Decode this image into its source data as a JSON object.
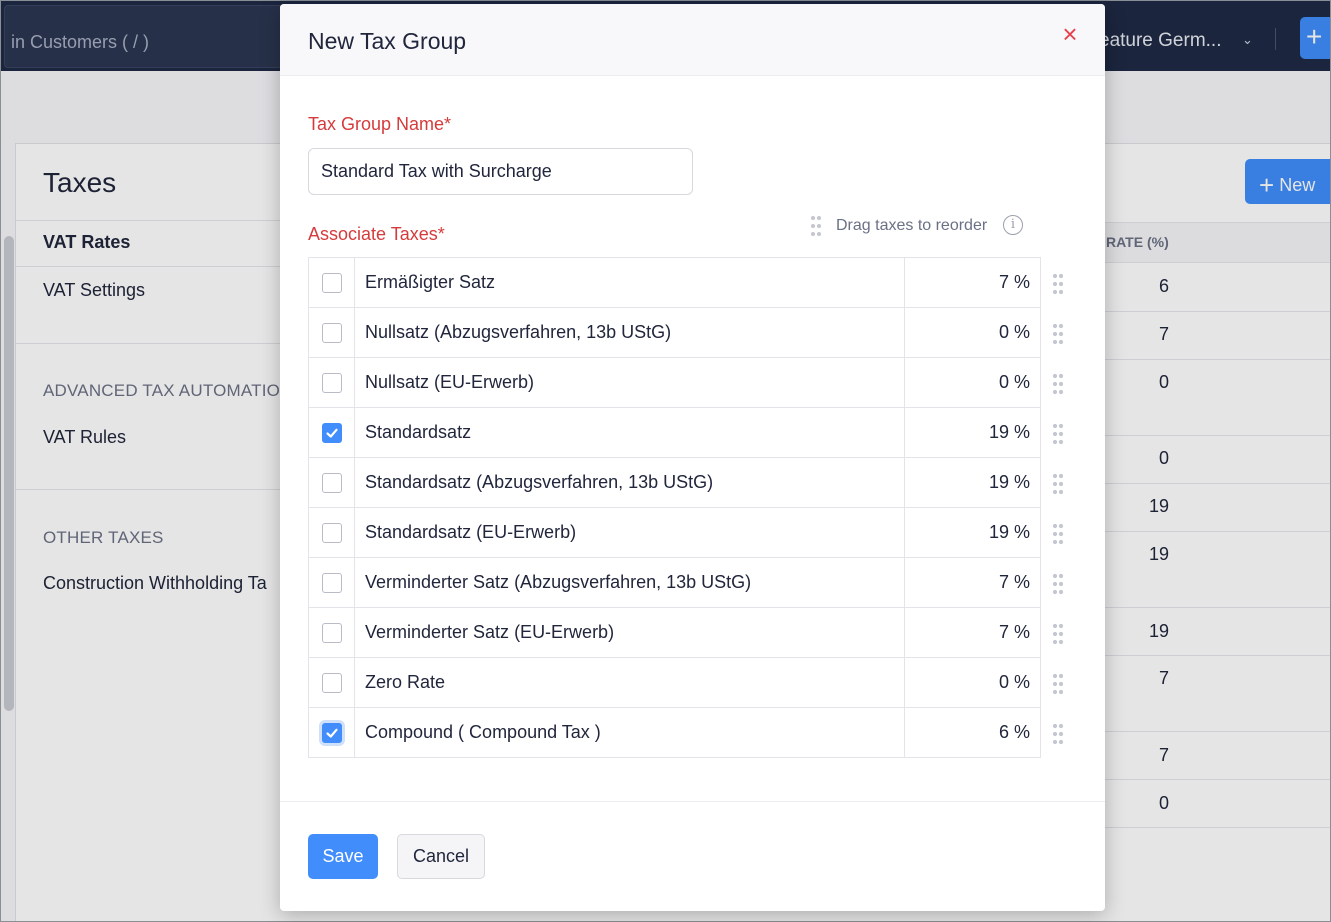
{
  "topbar": {
    "search_placeholder": "in Customers ( / )",
    "org_name": "eature Germ...",
    "quick_create_label": "+"
  },
  "sidebar": {
    "title": "Taxes",
    "items": [
      {
        "label": "VAT Rates",
        "active": true
      },
      {
        "label": "VAT Settings"
      }
    ],
    "sections": [
      {
        "heading": "ADVANCED TAX AUTOMATIO",
        "items": [
          {
            "label": "VAT Rules"
          }
        ]
      },
      {
        "heading": "OTHER TAXES",
        "items": [
          {
            "label": "Construction Withholding Ta"
          }
        ]
      }
    ]
  },
  "background_list": {
    "new_button_label": "New",
    "rate_header": "RATE (%)",
    "rates": [
      "6",
      "7",
      "0",
      "0",
      "19",
      "19",
      "19",
      "7",
      "7",
      "0"
    ]
  },
  "modal": {
    "title": "New Tax Group",
    "close_label": "×",
    "name_label": "Tax Group Name*",
    "name_value": "Standard Tax with Surcharge",
    "associate_label": "Associate Taxes*",
    "reorder_hint": "Drag taxes to reorder",
    "info_icon": "i",
    "taxes": [
      {
        "name": "Ermäßigter Satz",
        "rate": "7 %",
        "checked": false
      },
      {
        "name": "Nullsatz (Abzugsverfahren, 13b UStG)",
        "rate": "0 %",
        "checked": false
      },
      {
        "name": "Nullsatz (EU-Erwerb)",
        "rate": "0 %",
        "checked": false
      },
      {
        "name": "Standardsatz",
        "rate": "19 %",
        "checked": true
      },
      {
        "name": "Standardsatz (Abzugsverfahren, 13b UStG)",
        "rate": "19 %",
        "checked": false
      },
      {
        "name": "Standardsatz (EU-Erwerb)",
        "rate": "19 %",
        "checked": false
      },
      {
        "name": "Verminderter Satz (Abzugsverfahren, 13b UStG)",
        "rate": "7 %",
        "checked": false
      },
      {
        "name": "Verminderter Satz (EU-Erwerb)",
        "rate": "7 %",
        "checked": false
      },
      {
        "name": "Zero Rate",
        "rate": "0 %",
        "checked": false
      },
      {
        "name": "Compound ( Compound Tax )",
        "rate": "6 %",
        "checked": true
      }
    ],
    "save_label": "Save",
    "cancel_label": "Cancel"
  },
  "colors": {
    "accent": "#408dfb",
    "required_label": "#d63b3b",
    "close_icon": "#e5424d",
    "topbar": "#1f2a44"
  }
}
